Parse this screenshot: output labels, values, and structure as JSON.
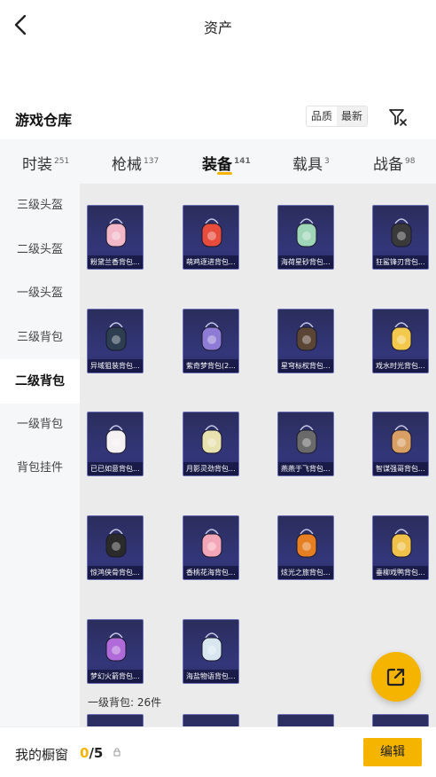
{
  "topbar": {
    "title": "资产"
  },
  "warehouse": {
    "title": "游戏仓库",
    "sort_options": [
      "品质",
      "最新"
    ]
  },
  "category_tabs": [
    {
      "label": "时装",
      "count": "251"
    },
    {
      "label": "枪械",
      "count": "137"
    },
    {
      "label": "装备",
      "count": "141",
      "active": true
    },
    {
      "label": "载具",
      "count": "3"
    },
    {
      "label": "战备",
      "count": "98"
    }
  ],
  "sidebar": [
    {
      "label": "三级头盔"
    },
    {
      "label": "二级头盔"
    },
    {
      "label": "一级头盔"
    },
    {
      "label": "三级背包"
    },
    {
      "label": "二级背包",
      "active": true
    },
    {
      "label": "一级背包"
    },
    {
      "label": "背包挂件"
    }
  ],
  "items": [
    {
      "name": "粉黛兰香背包...",
      "color": "#f2b8c8"
    },
    {
      "name": "萌鸡逐进背包...",
      "color": "#e84c3d"
    },
    {
      "name": "海荷星砂背包...",
      "color": "#9fd6b8"
    },
    {
      "name": "狂鲨锋刃背包...",
      "color": "#3a3a3a"
    },
    {
      "name": "异域狙装背包...",
      "color": "#2c3e50"
    },
    {
      "name": "紫奇梦背包(2...",
      "color": "#8e7bd6"
    },
    {
      "name": "星穹标权背包...",
      "color": "#5b4636"
    },
    {
      "name": "戏水时光背包...",
      "color": "#f2c94c"
    },
    {
      "name": "已已如意背包...",
      "color": "#f5f0f2"
    },
    {
      "name": "月影灵劲背包...",
      "color": "#e8e2b0"
    },
    {
      "name": "燕燕于飞背包...",
      "color": "#6a6a6a"
    },
    {
      "name": "智谋强哥背包...",
      "color": "#d9a066"
    },
    {
      "name": "惊鸿侠骨背包...",
      "color": "#2a2a2a"
    },
    {
      "name": "香桃花海背包...",
      "color": "#f4a6b9"
    },
    {
      "name": "炫光之旅背包...",
      "color": "#e67e22"
    },
    {
      "name": "垂柳戏鸭背包...",
      "color": "#f0c24b"
    },
    {
      "name": "梦幻火箭背包...",
      "color": "#b06ad9"
    },
    {
      "name": "海盐物语背包...",
      "color": "#d8e6f0"
    }
  ],
  "section_label": "一级背包: 26件",
  "bottom": {
    "showcase_label": "我的橱窗",
    "count_current": "0",
    "count_sep": "/",
    "count_max": "5",
    "edit_label": "编辑"
  },
  "colors": {
    "accent": "#f5b400",
    "card_bg": "#2b2d5c",
    "sidebar_bg": "#f6f7f8"
  },
  "icons": [
    "back-arrow-icon",
    "filter-icon",
    "lock-icon",
    "share-external-icon"
  ]
}
